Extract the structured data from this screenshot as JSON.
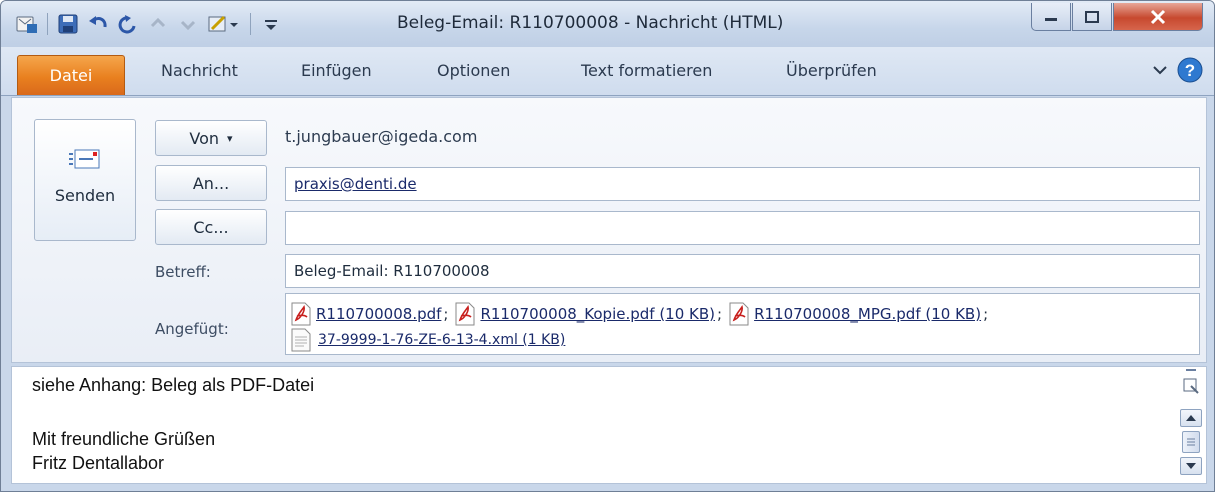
{
  "window": {
    "title": "Beleg-Email: R110700008  -  Nachricht (HTML)"
  },
  "ribbon": {
    "tabs": [
      {
        "label": "Datei"
      },
      {
        "label": "Nachricht"
      },
      {
        "label": "Einfügen"
      },
      {
        "label": "Optionen"
      },
      {
        "label": "Text formatieren"
      },
      {
        "label": "Überprüfen"
      }
    ]
  },
  "compose": {
    "send_label": "Senden",
    "from_button": "Von",
    "from_value": "t.jungbauer@igeda.com",
    "to_button": "An...",
    "to_value": "praxis@denti.de",
    "cc_button": "Cc...",
    "cc_value": "",
    "subject_label": "Betreff:",
    "subject_value": "Beleg-Email: R110700008",
    "attached_label": "Angefügt:",
    "attachments": [
      {
        "name": "R110700008.pdf",
        "type": "pdf"
      },
      {
        "name": "R110700008_Kopie.pdf (10 KB)",
        "type": "pdf"
      },
      {
        "name": "R110700008_MPG.pdf (10 KB)",
        "type": "pdf"
      },
      {
        "name": "37-9999-1-76-ZE-6-13-4.xml (1 KB)",
        "type": "xml"
      }
    ],
    "attachment_separator": ";"
  },
  "body": {
    "lines": [
      "siehe Anhang: Beleg als PDF-Datei",
      "",
      "Mit freundliche Grüßen",
      "Fritz Dentallabor"
    ]
  },
  "icons": {
    "qat": [
      "outlook-icon",
      "save-icon",
      "undo-icon",
      "redo-icon",
      "previous-item-icon",
      "next-item-icon",
      "format-painter-icon",
      "customize-qat-icon"
    ],
    "window_controls": [
      "minimize-icon",
      "maximize-icon",
      "close-icon"
    ],
    "ribbon_right": [
      "collapse-ribbon-icon",
      "help-icon"
    ]
  },
  "colors": {
    "file_tab": "#e9801f",
    "close_button": "#c7492f",
    "link": "#1a2a6a"
  }
}
